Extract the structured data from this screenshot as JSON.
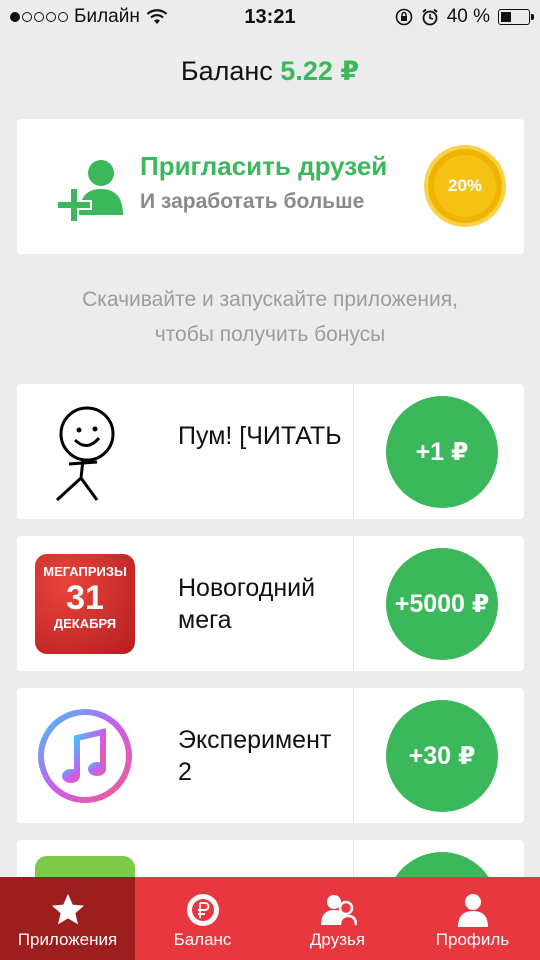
{
  "status_bar": {
    "carrier": "Билайн",
    "time": "13:21",
    "battery": "40 %",
    "battery_level": 0.4
  },
  "header": {
    "balance_label": "Баланс",
    "balance_value": "5.22 ₽"
  },
  "invite": {
    "title": "Пригласить друзей",
    "subtitle": "И заработать больше",
    "bonus": "20%"
  },
  "promo": {
    "line1": "Скачивайте и запускайте приложения,",
    "line2": "чтобы получить бонусы"
  },
  "apps": [
    {
      "name": "Пум! [ЧИТАТЬ",
      "reward": "+1 ₽",
      "icon": "stick-figure-icon"
    },
    {
      "name": "Новогодний мега",
      "reward": "+5000 ₽",
      "icon": "megaprizes-icon",
      "icon_text": {
        "l1": "МЕГАПРИЗЫ",
        "l2": "31",
        "l3": "ДЕКАБРЯ"
      }
    },
    {
      "name": "Эксперимент 2",
      "reward": "+30 ₽",
      "icon": "music-note-icon"
    }
  ],
  "tabs": [
    {
      "label": "Приложения",
      "icon": "star-icon",
      "active": true
    },
    {
      "label": "Баланс",
      "icon": "ruble-coin-icon",
      "active": false
    },
    {
      "label": "Друзья",
      "icon": "friends-icon",
      "active": false
    },
    {
      "label": "Профиль",
      "icon": "profile-icon",
      "active": false
    }
  ],
  "colors": {
    "accent_green": "#3cb85c",
    "tab_bar": "#e8373e",
    "tab_active": "#9c1e1f",
    "coin": "#f6c216"
  }
}
